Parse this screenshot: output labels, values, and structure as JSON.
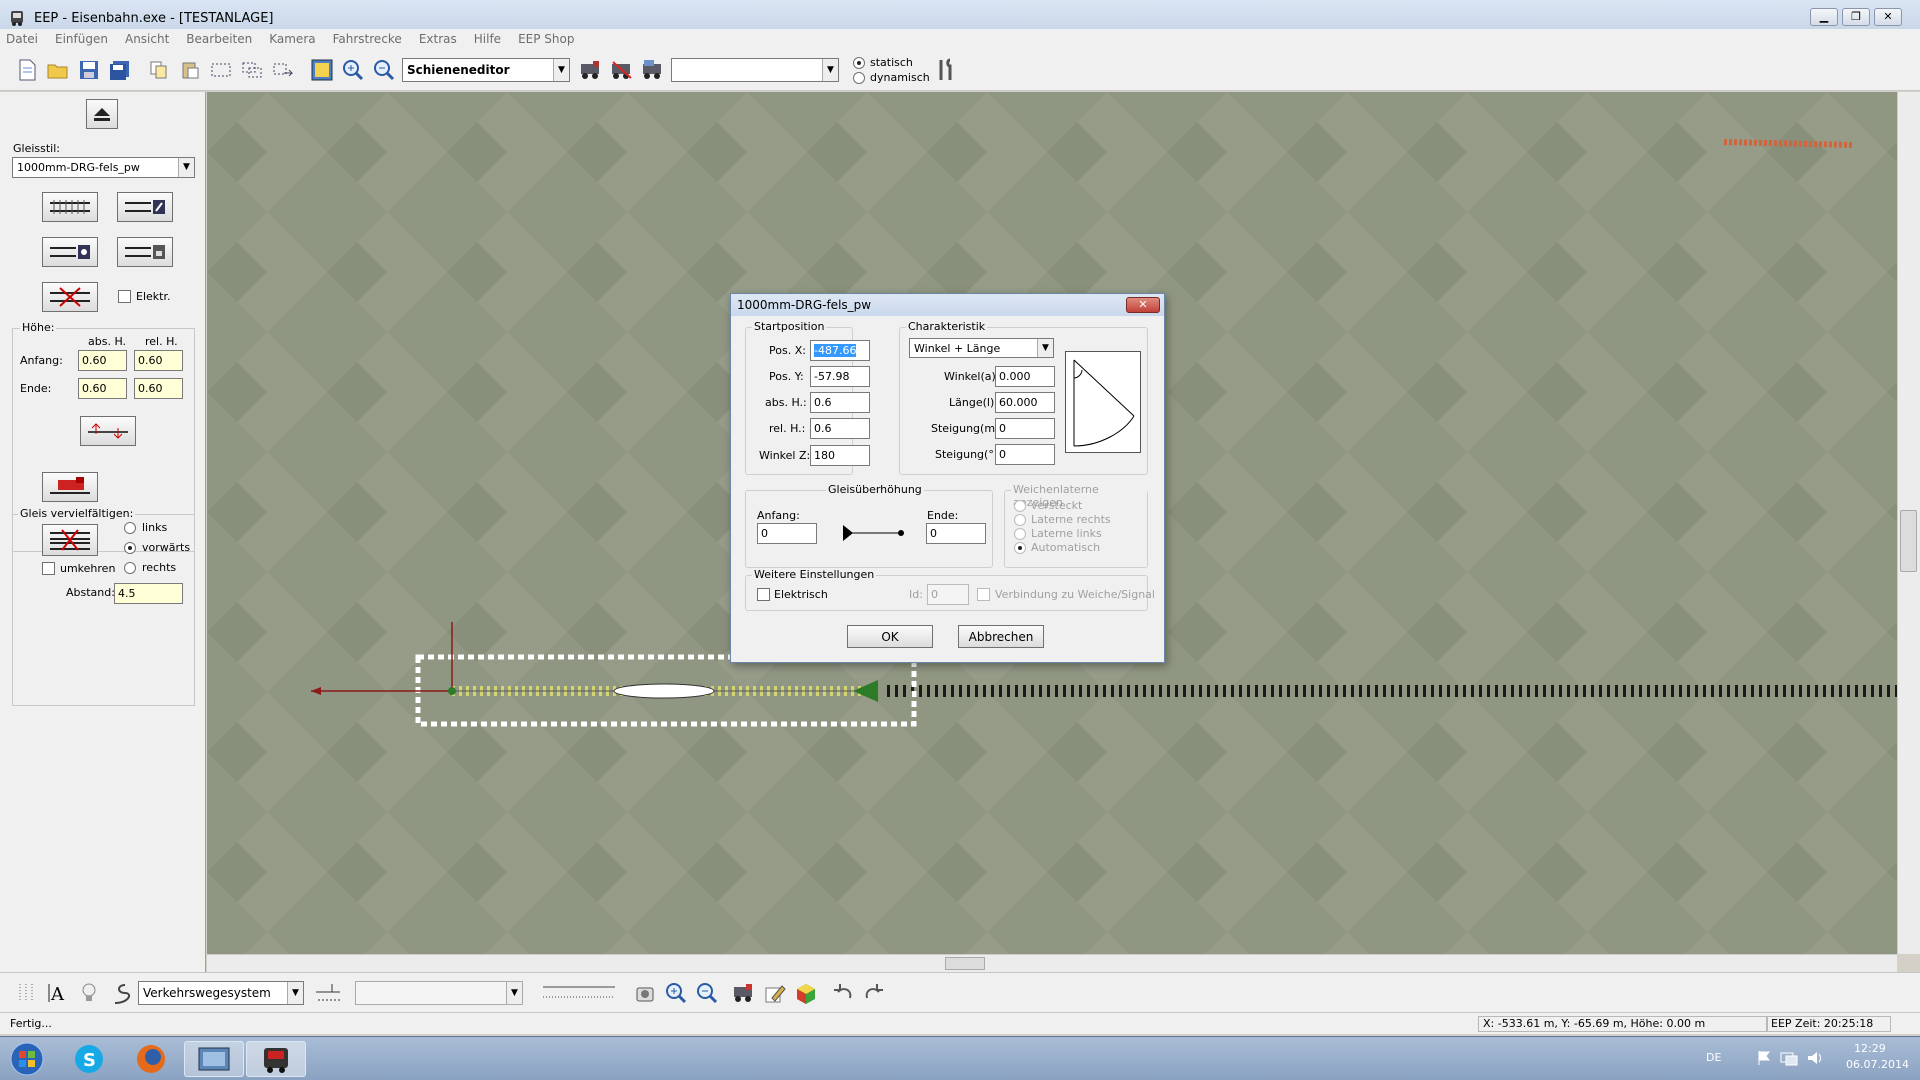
{
  "window": {
    "title": "EEP - Eisenbahn.exe - [TESTANLAGE]"
  },
  "menu": [
    "Datei",
    "Einfügen",
    "Ansicht",
    "Bearbeiten",
    "Kamera",
    "Fahrstrecke",
    "Extras",
    "Hilfe",
    "EEP Shop"
  ],
  "toolbar": {
    "editor_select": "Schieneneditor",
    "object_combo": "",
    "mode_static": "statisch",
    "mode_dynamic": "dynamisch",
    "selected_mode": "statisch"
  },
  "left": {
    "gleisstil_label": "Gleisstil:",
    "gleisstil_value": "1000mm-DRG-fels_pw",
    "elektr_label": "Elektr.",
    "hoehe_label": "Höhe:",
    "abs_h": "abs. H.",
    "rel_h": "rel. H.",
    "anfang_label": "Anfang:",
    "anfang_abs": "0.60",
    "anfang_rel": "0.60",
    "ende_label": "Ende:",
    "ende_abs": "0.60",
    "ende_rel": "0.60",
    "vervielf_label": "Gleis vervielfältigen:",
    "links": "links",
    "vorwaerts": "vorwärts",
    "rechts": "rechts",
    "umkehren": "umkehren",
    "abstand_label": "Abstand:",
    "abstand_value": "4.5"
  },
  "dialog": {
    "title": "1000mm-DRG-fels_pw",
    "close": "✕",
    "start": {
      "group": "Startposition",
      "posx_label": "Pos. X:",
      "posx": "-487.66",
      "posy_label": "Pos. Y:",
      "posy": "-57.98",
      "absh_label": "abs. H.:",
      "absh": "0.6",
      "relh_label": "rel. H.:",
      "relh": "0.6",
      "winkelz_label": "Winkel Z:",
      "winkelz": "180"
    },
    "char": {
      "group": "Charakteristik",
      "mode": "Winkel + Länge",
      "winkel_label": "Winkel(a):",
      "winkel": "0.000",
      "laenge_label": "Länge(l):",
      "laenge": "60.000",
      "steigm_label": "Steigung(m):",
      "steigm": "0",
      "steigg_label": "Steigung(°):",
      "steigg": "0"
    },
    "ueber": {
      "group": "Gleisüberhöhung",
      "anfang_label": "Anfang:",
      "anfang": "0",
      "ende_label": "Ende:",
      "ende": "0"
    },
    "laterne": {
      "group": "Weichenlaterne anzeigen",
      "opt1": "versteckt",
      "opt2": "Laterne rechts",
      "opt3": "Laterne links",
      "opt4": "Automatisch"
    },
    "weitere": {
      "group": "Weitere Einstellungen",
      "elektrisch": "Elektrisch",
      "id_label": "Id:",
      "id": "0",
      "verbindung": "Verbindung zu Weiche/Signal"
    },
    "ok": "OK",
    "cancel": "Abbrechen"
  },
  "bottom": {
    "system_select": "Verkehrswegesystem",
    "combo2": ""
  },
  "status": {
    "text": "Fertig...",
    "coords": "X: -533.61 m, Y: -65.69 m, Höhe: 0.00 m",
    "time": "EEP Zeit: 20:25:18"
  },
  "taskbar": {
    "lang": "DE",
    "clock": "12:29",
    "date": "06.07.2014"
  }
}
